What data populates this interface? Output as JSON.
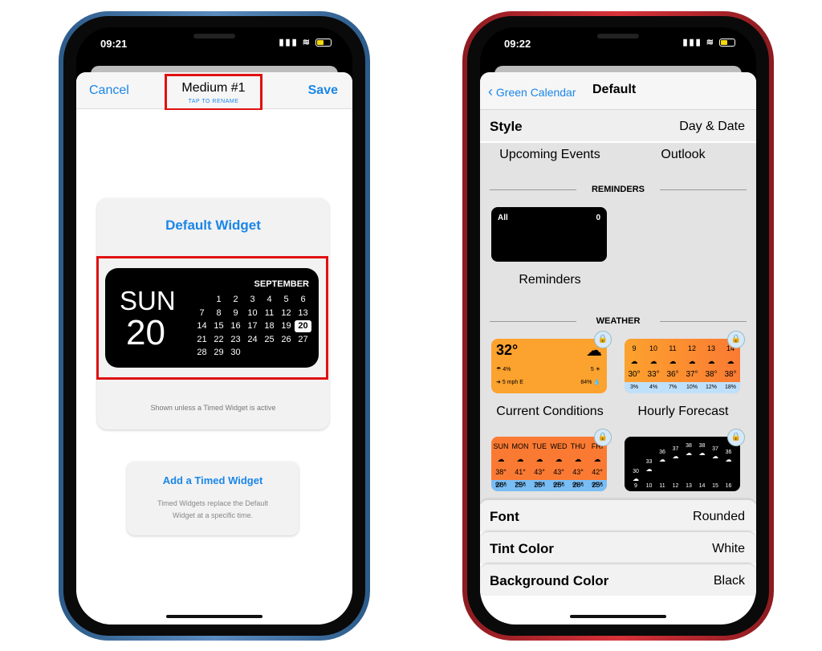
{
  "left": {
    "status_time": "09:21",
    "cancel": "Cancel",
    "title": "Medium #1",
    "subtitle": "TAP TO RENAME",
    "save": "Save",
    "widget_title": "Default Widget",
    "cal": {
      "dow": "SUN",
      "day": "20",
      "month": "SEPTEMBER",
      "today": "20",
      "weeks": [
        [
          "",
          "1",
          "2",
          "3",
          "4",
          "5",
          "6"
        ],
        [
          "7",
          "8",
          "9",
          "10",
          "11",
          "12",
          "13"
        ],
        [
          "14",
          "15",
          "16",
          "17",
          "18",
          "19",
          "20"
        ],
        [
          "21",
          "22",
          "23",
          "24",
          "25",
          "26",
          "27"
        ],
        [
          "28",
          "29",
          "30",
          "",
          "",
          "",
          ""
        ]
      ]
    },
    "caption": "Shown unless a Timed Widget is active",
    "timed_title": "Add a Timed Widget",
    "timed_desc": "Timed Widgets replace the Default Widget at a specific time.",
    "frame_color": "#3f74a8"
  },
  "right": {
    "status_time": "09:22",
    "back": "Green Calendar",
    "title": "Default",
    "style_key": "Style",
    "style_value": "Day & Date",
    "labels": {
      "upcoming": "Upcoming Events",
      "outlook": "Outlook",
      "reminders": "Reminders",
      "current": "Current Conditions",
      "hourly": "Hourly Forecast"
    },
    "sections": {
      "reminders": "REMINDERS",
      "weather": "WEATHER"
    },
    "reminders_widget": {
      "label": "All",
      "count": "0"
    },
    "current": {
      "temp": "32°",
      "rain": "4%",
      "uv": "5",
      "wind": "5 mph E",
      "humidity": "84%"
    },
    "hourly": {
      "hours": [
        "9",
        "10",
        "11",
        "12",
        "13",
        "14"
      ],
      "temps": [
        "30°",
        "33°",
        "36°",
        "37°",
        "38°",
        "38°"
      ],
      "pct": [
        "3%",
        "4%",
        "7%",
        "10%",
        "12%",
        "18%"
      ]
    },
    "daily": {
      "days": [
        "SUN",
        "MON",
        "TUE",
        "WED",
        "THU",
        "FRI"
      ],
      "highs": [
        "38°",
        "41°",
        "43°",
        "43°",
        "43°",
        "42°"
      ],
      "lows": [
        "26°",
        "25°",
        "25°",
        "25°",
        "26°",
        "25°"
      ],
      "pct": [
        "92%",
        "75%",
        "78%",
        "99%",
        "95%",
        "95%"
      ]
    },
    "chart": {
      "hours": [
        "9",
        "10",
        "11",
        "12",
        "13",
        "14",
        "15",
        "16"
      ],
      "temps": [
        "30",
        "33",
        "36",
        "37",
        "38",
        "38",
        "37",
        "36"
      ]
    },
    "rows": [
      {
        "k": "Font",
        "v": "Rounded"
      },
      {
        "k": "Tint Color",
        "v": "White"
      },
      {
        "k": "Background Color",
        "v": "Black"
      }
    ],
    "frame_color": "#c8262e",
    "accent": "#1a86e8"
  }
}
